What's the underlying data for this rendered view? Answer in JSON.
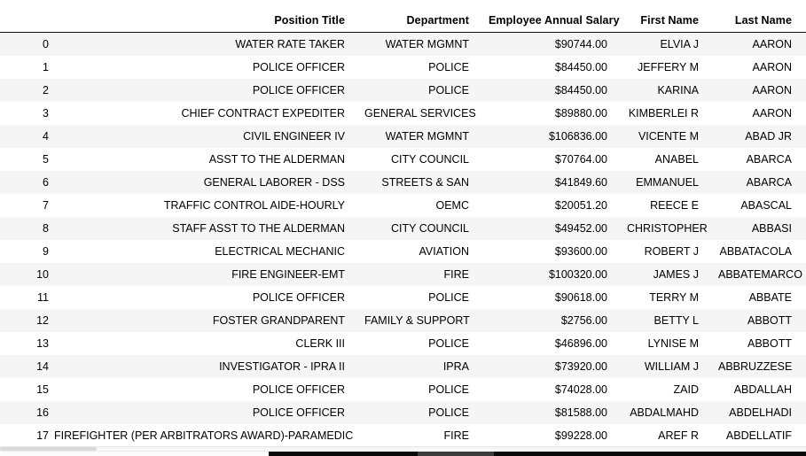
{
  "table": {
    "index_header": "",
    "columns": [
      "Position Title",
      "Department",
      "Employee Annual Salary",
      "First Name",
      "Last Name"
    ],
    "rows": [
      {
        "index": "0",
        "position_title": "WATER RATE TAKER",
        "department": "WATER MGMNT",
        "salary": "$90744.00",
        "first_name": "ELVIA J",
        "last_name": "AARON"
      },
      {
        "index": "1",
        "position_title": "POLICE OFFICER",
        "department": "POLICE",
        "salary": "$84450.00",
        "first_name": "JEFFERY M",
        "last_name": "AARON"
      },
      {
        "index": "2",
        "position_title": "POLICE OFFICER",
        "department": "POLICE",
        "salary": "$84450.00",
        "first_name": "KARINA",
        "last_name": "AARON"
      },
      {
        "index": "3",
        "position_title": "CHIEF CONTRACT EXPEDITER",
        "department": "GENERAL SERVICES",
        "salary": "$89880.00",
        "first_name": "KIMBERLEI R",
        "last_name": "AARON"
      },
      {
        "index": "4",
        "position_title": "CIVIL ENGINEER IV",
        "department": "WATER MGMNT",
        "salary": "$106836.00",
        "first_name": "VICENTE M",
        "last_name": "ABAD JR"
      },
      {
        "index": "5",
        "position_title": "ASST TO THE ALDERMAN",
        "department": "CITY COUNCIL",
        "salary": "$70764.00",
        "first_name": "ANABEL",
        "last_name": "ABARCA"
      },
      {
        "index": "6",
        "position_title": "GENERAL LABORER - DSS",
        "department": "STREETS & SAN",
        "salary": "$41849.60",
        "first_name": "EMMANUEL",
        "last_name": "ABARCA"
      },
      {
        "index": "7",
        "position_title": "TRAFFIC CONTROL AIDE-HOURLY",
        "department": "OEMC",
        "salary": "$20051.20",
        "first_name": "REECE E",
        "last_name": "ABASCAL"
      },
      {
        "index": "8",
        "position_title": "STAFF ASST TO THE ALDERMAN",
        "department": "CITY COUNCIL",
        "salary": "$49452.00",
        "first_name": "CHRISTOPHER",
        "last_name": "ABBASI"
      },
      {
        "index": "9",
        "position_title": "ELECTRICAL MECHANIC",
        "department": "AVIATION",
        "salary": "$93600.00",
        "first_name": "ROBERT J",
        "last_name": "ABBATACOLA"
      },
      {
        "index": "10",
        "position_title": "FIRE ENGINEER-EMT",
        "department": "FIRE",
        "salary": "$100320.00",
        "first_name": "JAMES J",
        "last_name": "ABBATEMARCO"
      },
      {
        "index": "11",
        "position_title": "POLICE OFFICER",
        "department": "POLICE",
        "salary": "$90618.00",
        "first_name": "TERRY M",
        "last_name": "ABBATE"
      },
      {
        "index": "12",
        "position_title": "FOSTER GRANDPARENT",
        "department": "FAMILY & SUPPORT",
        "salary": "$2756.00",
        "first_name": "BETTY L",
        "last_name": "ABBOTT"
      },
      {
        "index": "13",
        "position_title": "CLERK III",
        "department": "POLICE",
        "salary": "$46896.00",
        "first_name": "LYNISE M",
        "last_name": "ABBOTT"
      },
      {
        "index": "14",
        "position_title": "INVESTIGATOR - IPRA II",
        "department": "IPRA",
        "salary": "$73920.00",
        "first_name": "WILLIAM J",
        "last_name": "ABBRUZZESE"
      },
      {
        "index": "15",
        "position_title": "POLICE OFFICER",
        "department": "POLICE",
        "salary": "$74028.00",
        "first_name": "ZAID",
        "last_name": "ABDALLAH"
      },
      {
        "index": "16",
        "position_title": "POLICE OFFICER",
        "department": "POLICE",
        "salary": "$81588.00",
        "first_name": "ABDALMAHD",
        "last_name": "ABDELHADI"
      },
      {
        "index": "17",
        "position_title": "FIREFIGHTER (PER ARBITRATORS AWARD)-PARAMEDIC",
        "department": "FIRE",
        "salary": "$99228.00",
        "first_name": "AREF R",
        "last_name": "ABDELLATIF"
      }
    ]
  },
  "scrollbar": {
    "orientation": "horizontal",
    "thumb_position_pct": 0,
    "thumb_width_pct": 12
  },
  "colors": {
    "row_stripe": "#f5f5f5",
    "row_plain": "#ffffff",
    "header_rule": "#111111",
    "text": "#000000"
  }
}
